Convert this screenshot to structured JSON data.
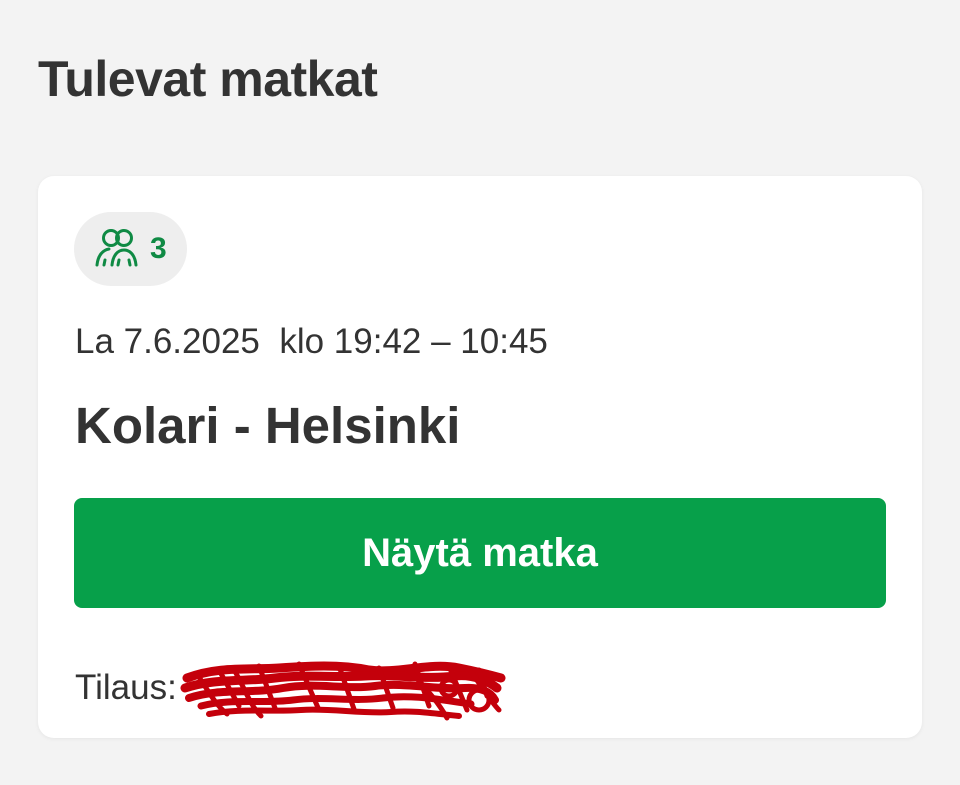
{
  "page": {
    "title": "Tulevat matkat"
  },
  "trip": {
    "passengers": "3",
    "passengers_icon": "people-icon",
    "datetime": "La 7.6.2025  klo 19:42 – 10:45",
    "route": "Kolari - Helsinki",
    "show_button_label": "Näytä matka",
    "order_label": "Tilaus:"
  },
  "colors": {
    "accent_green": "#07a04a",
    "icon_green": "#0f8a44",
    "redaction_red": "#c4000b"
  }
}
